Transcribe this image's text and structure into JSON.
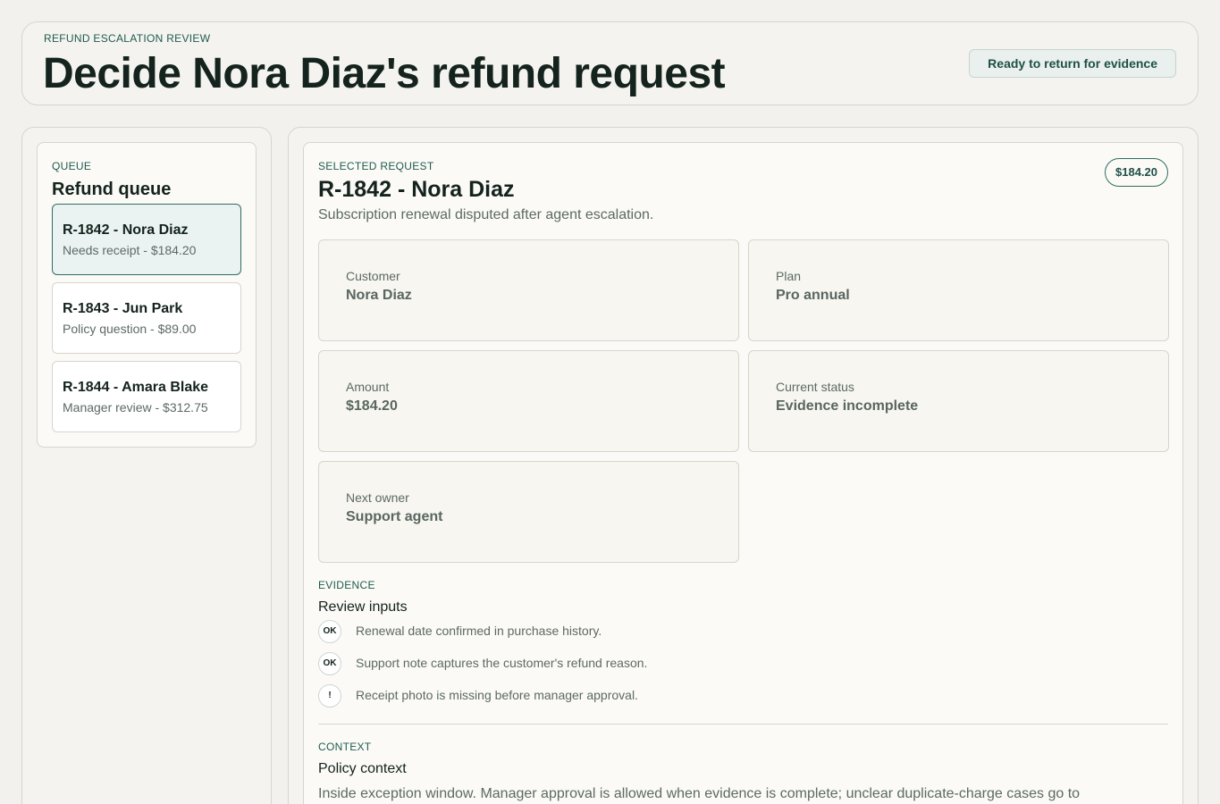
{
  "header": {
    "eyebrow": "REFUND ESCALATION REVIEW",
    "title": "Decide Nora Diaz's refund request",
    "status": "Ready to return for evidence"
  },
  "queue": {
    "eyebrow": "QUEUE",
    "title": "Refund queue",
    "items": [
      {
        "title": "R-1842 - Nora Diaz",
        "subtitle": "Needs receipt - $184.20",
        "selected": true
      },
      {
        "title": "R-1843 - Jun Park",
        "subtitle": "Policy question - $89.00",
        "selected": false
      },
      {
        "title": "R-1844 - Amara Blake",
        "subtitle": "Manager review - $312.75",
        "selected": false
      }
    ]
  },
  "request": {
    "eyebrow": "SELECTED REQUEST",
    "title": "R-1842 - Nora Diaz",
    "subtitle": "Subscription renewal disputed after agent escalation.",
    "amount_badge": "$184.20",
    "fields": [
      {
        "label": "Customer",
        "value": "Nora Diaz"
      },
      {
        "label": "Plan",
        "value": "Pro annual"
      },
      {
        "label": "Amount",
        "value": "$184.20"
      },
      {
        "label": "Current status",
        "value": "Evidence incomplete"
      },
      {
        "label": "Next owner",
        "value": "Support agent"
      }
    ]
  },
  "evidence": {
    "eyebrow": "EVIDENCE",
    "title": "Review inputs",
    "items": [
      {
        "icon": "OK",
        "text": "Renewal date confirmed in purchase history."
      },
      {
        "icon": "OK",
        "text": "Support note captures the customer's refund reason."
      },
      {
        "icon": "!",
        "text": "Receipt photo is missing before manager approval."
      }
    ]
  },
  "context": {
    "eyebrow": "CONTEXT",
    "title": "Policy context",
    "text": "Inside exception window. Manager approval is allowed when evidence is complete; unclear duplicate-charge cases go to"
  },
  "colors": {
    "accent": "#2f6e60",
    "background": "#f2f1ed",
    "selected_bg": "#eaf3f1"
  }
}
